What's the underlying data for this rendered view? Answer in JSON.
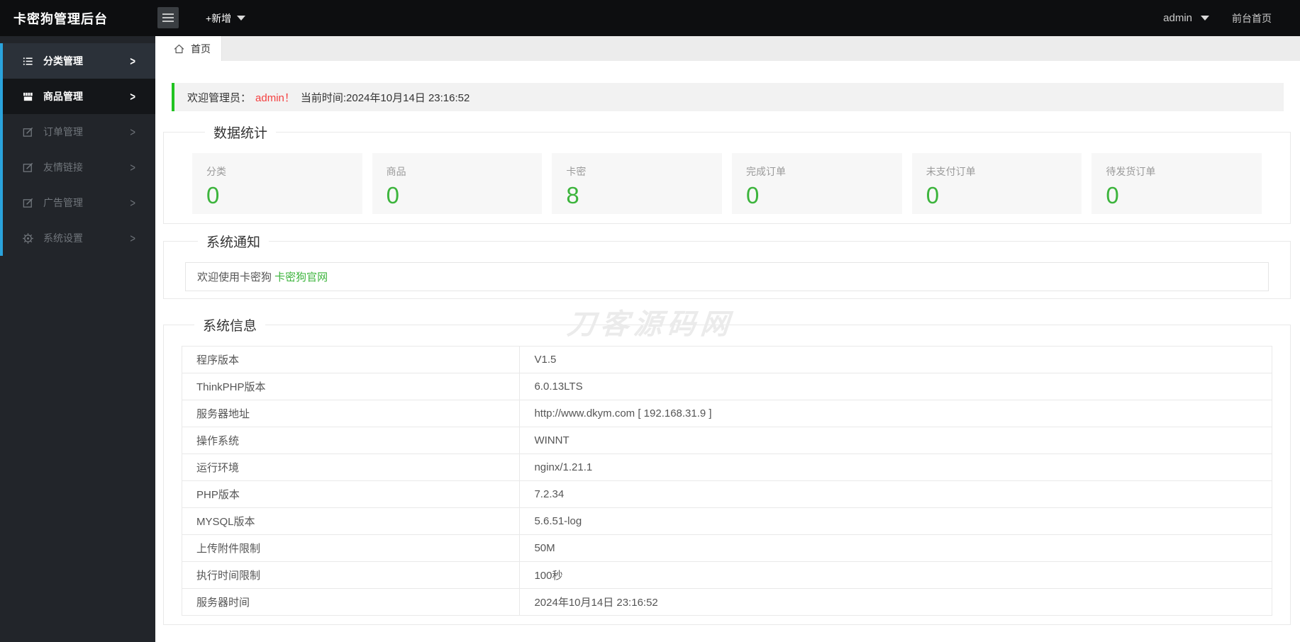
{
  "app": {
    "title": "卡密狗管理后台"
  },
  "topbar": {
    "add_button": "+新增",
    "user": "admin",
    "front_home": "前台首页"
  },
  "sidebar": {
    "items": [
      {
        "label": "分类管理",
        "icon": "list-icon"
      },
      {
        "label": "商品管理",
        "icon": "shop-icon"
      },
      {
        "label": "订单管理",
        "icon": "edit-icon"
      },
      {
        "label": "友情链接",
        "icon": "edit-icon"
      },
      {
        "label": "广告管理",
        "icon": "edit-icon"
      },
      {
        "label": "系统设置",
        "icon": "gear-icon"
      }
    ],
    "chevron": ">"
  },
  "tabs": {
    "active": "首页"
  },
  "welcome": {
    "prefix": "欢迎管理员：",
    "username": "admin！",
    "suffix": "当前时间:2024年10月14日 23:16:52"
  },
  "stats": {
    "section_title": "数据统计",
    "cards": [
      {
        "label": "分类",
        "value": "0"
      },
      {
        "label": "商品",
        "value": "0"
      },
      {
        "label": "卡密",
        "value": "8"
      },
      {
        "label": "完成订单",
        "value": "0"
      },
      {
        "label": "未支付订单",
        "value": "0"
      },
      {
        "label": "待发货订单",
        "value": "0"
      }
    ]
  },
  "notice": {
    "section_title": "系统通知",
    "text": "欢迎使用卡密狗 ",
    "link_label": "卡密狗官网"
  },
  "sysinfo": {
    "section_title": "系统信息",
    "rows": [
      [
        "程序版本",
        "V1.5"
      ],
      [
        "ThinkPHP版本",
        "6.0.13LTS"
      ],
      [
        "服务器地址",
        "http://www.dkym.com [ 192.168.31.9 ]"
      ],
      [
        "操作系统",
        "WINNT"
      ],
      [
        "运行环境",
        "nginx/1.21.1"
      ],
      [
        "PHP版本",
        "7.2.34"
      ],
      [
        "MYSQL版本",
        "5.6.51-log"
      ],
      [
        "上传附件限制",
        "50M"
      ],
      [
        "执行时间限制",
        "100秒"
      ],
      [
        "服务器时间",
        "2024年10月14日 23:16:52"
      ]
    ]
  },
  "watermark": "刀客源码网",
  "colors": {
    "topbar_bg": "#0d0e10",
    "sidebar_bg": "#22252a",
    "sidebar_item_hover_bg": "#2b3139",
    "sidebar_item_open_bg": "#141619",
    "sidebar_accent": "#2aa3dc",
    "accent_green": "#3cb43c",
    "welcome_accent": "#21c321",
    "danger_red": "#f43f3f",
    "card_bg": "#f7f7f7",
    "border": "#e9e9e9"
  }
}
